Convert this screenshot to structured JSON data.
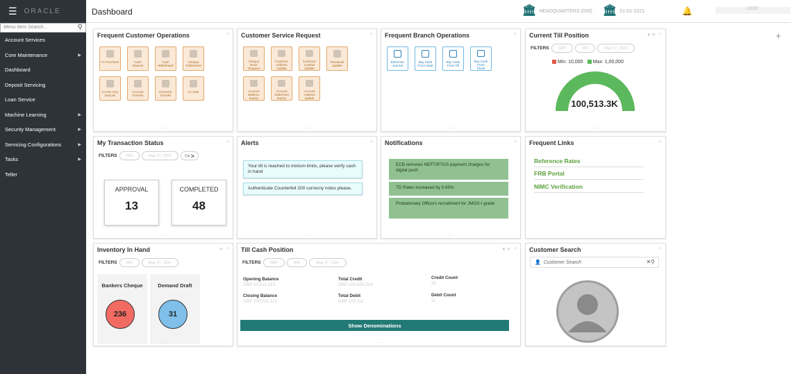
{
  "topbar": {
    "menu_icon": "hamburger-icon",
    "logo_text": "ORACLE",
    "title": "Dashboard",
    "branch1": "HEADQUARTERS (000)",
    "branch2": "01-01-2021",
    "user": "USER"
  },
  "sidebar": {
    "search_placeholder": "Menu Item Search...",
    "items": [
      {
        "label": "Account Services",
        "has_children": false
      },
      {
        "label": "Core Maintenance",
        "has_children": true
      },
      {
        "label": "Dashboard",
        "has_children": false
      },
      {
        "label": "Deposit Servicing",
        "has_children": false
      },
      {
        "label": "Loan Service",
        "has_children": false
      },
      {
        "label": "Machine Learning",
        "has_children": true
      },
      {
        "label": "Security Management",
        "has_children": true
      },
      {
        "label": "Servicing Configurations",
        "has_children": true
      },
      {
        "label": "Tasks",
        "has_children": true
      },
      {
        "label": "Teller",
        "has_children": false
      }
    ]
  },
  "fco": {
    "title": "Frequent Customer Operations",
    "tiles": [
      {
        "line1": "Fx Purchase",
        "line2": ""
      },
      {
        "line1": "Cash",
        "line2": "Deposit"
      },
      {
        "line1": "Cash",
        "line2": "Withdrawal"
      },
      {
        "line1": "Cheque",
        "line2": "Withdrawal"
      },
      {
        "line1": "In-Hse Chq",
        "line2": "Deposit"
      },
      {
        "line1": "Account",
        "line2": "Transfer"
      },
      {
        "line1": "Domestic",
        "line2": "Transfer"
      },
      {
        "line1": "Fx Sale",
        "line2": ""
      }
    ]
  },
  "csr": {
    "title": "Customer Service Request",
    "tiles": [
      {
        "line1": "Cheque",
        "line2": "Book",
        "line3": "Request"
      },
      {
        "line1": "Customer",
        "line2": "Address",
        "line3": "Update"
      },
      {
        "line1": "Customer",
        "line2": "Contact",
        "line3": "Update"
      },
      {
        "line1": "Passbook",
        "line2": "Update",
        "line3": ""
      },
      {
        "line1": "Account",
        "line2": "Balance",
        "line3": "Inquiry"
      },
      {
        "line1": "Account",
        "line2": "Statement",
        "line3": "Inquiry"
      },
      {
        "line1": "Account",
        "line2": "Address",
        "line3": "update"
      }
    ]
  },
  "fbo": {
    "title": "Frequent Branch Operations",
    "tiles": [
      {
        "line1": "Electronic",
        "line2": "Journal",
        "line3": ""
      },
      {
        "line1": "Buy Cash",
        "line2": "From Vault",
        "line3": ""
      },
      {
        "line1": "Buy Cash",
        "line2": "From Till",
        "line3": ""
      },
      {
        "line1": "Buy Cash",
        "line2": "From",
        "line3": "Chest"
      }
    ]
  },
  "till": {
    "title": "Current Till Position",
    "filters_label": "FILTERS",
    "filters": [
      "GBP",
      "000",
      "May 27, 2021"
    ],
    "min_label": "Min: 10,000",
    "max_label": "Max: 1,00,000",
    "min_color": "#e05a4e",
    "max_color": "#5cb85c",
    "value": "100,513.3K",
    "gauge_fraction": 1.0
  },
  "txn": {
    "title": "My Transaction Status",
    "filters_label": "FILTERS",
    "filters": [
      "000",
      "May 27, 2021",
      "Ca"
    ],
    "approval_label": "APPROVAL",
    "approval_value": "13",
    "completed_label": "COMPLETED",
    "completed_value": "48"
  },
  "alerts": {
    "title": "Alerts",
    "items": [
      "Your till is reached to minium limits, please verify cash in hand",
      "Authenticate Counterfeit 200 currecny notes please."
    ]
  },
  "notifications": {
    "title": "Notifications",
    "items": [
      "ECB removes NEFT/RTGS payment charges for digital push",
      "TD Rates increased by 0.65%",
      "Probationary Officers recruitment for JMGS-I grade"
    ]
  },
  "links": {
    "title": "Frequent Links",
    "items": [
      "Reference Rates",
      "FRB Portal",
      "NIMC Verification"
    ]
  },
  "inventory": {
    "title": "Inventory In Hand",
    "filters_label": "FILTERS",
    "filters": [
      "000",
      "May 27, 2021"
    ],
    "cards": [
      {
        "label": "Bankers Cheque",
        "value": "236",
        "color": "#f26b63"
      },
      {
        "label": "Demand Draft",
        "value": "31",
        "color": "#7fbfea"
      }
    ]
  },
  "tillcash": {
    "title": "Till Cash Position",
    "filters_label": "FILTERS",
    "filters": [
      "GBP",
      "000",
      "May 27, 2021"
    ],
    "opening_label": "Opening Balance",
    "opening_value": "GBP 10,511,223",
    "closing_label": "Closing Balance",
    "closing_value": "GBP 100,511,312",
    "credit_label": "Total Credit",
    "credit_value": "GBP 100,600,504",
    "debit_label": "Total Debit",
    "debit_value": "GBP 100,111",
    "credit_count_label": "Credit Count",
    "credit_count_value": "25",
    "debit_count_label": "Debit Count",
    "debit_count_value": "11",
    "button": "Show Denominations"
  },
  "custsearch": {
    "title": "Customer Search",
    "placeholder": "Customer Search"
  },
  "footer_dots": "....",
  "close_glyph": "×",
  "plus_glyph": "+"
}
